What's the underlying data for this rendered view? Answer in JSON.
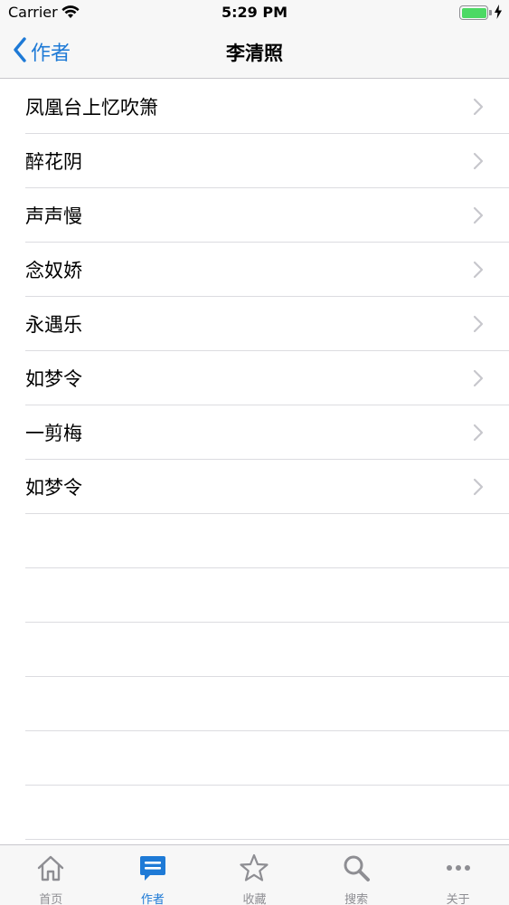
{
  "status_bar": {
    "carrier": "Carrier",
    "time": "5:29 PM",
    "battery_level": 1.0,
    "battery_color": "#4cd964"
  },
  "nav_bar": {
    "back_label": "作者",
    "title": "李清照",
    "accent_color": "#1e7ad6"
  },
  "list": {
    "items": [
      {
        "label": "凤凰台上忆吹箫"
      },
      {
        "label": "醉花阴"
      },
      {
        "label": "声声慢"
      },
      {
        "label": "念奴娇"
      },
      {
        "label": "永遇乐"
      },
      {
        "label": "如梦令"
      },
      {
        "label": "一剪梅"
      },
      {
        "label": "如梦令"
      }
    ]
  },
  "tab_bar": {
    "tabs": [
      {
        "label": "首页",
        "icon": "home-icon"
      },
      {
        "label": "作者",
        "icon": "chat-bubble-icon",
        "active": true
      },
      {
        "label": "收藏",
        "icon": "star-icon"
      },
      {
        "label": "搜索",
        "icon": "search-icon"
      },
      {
        "label": "关于",
        "icon": "more-icon"
      }
    ]
  }
}
